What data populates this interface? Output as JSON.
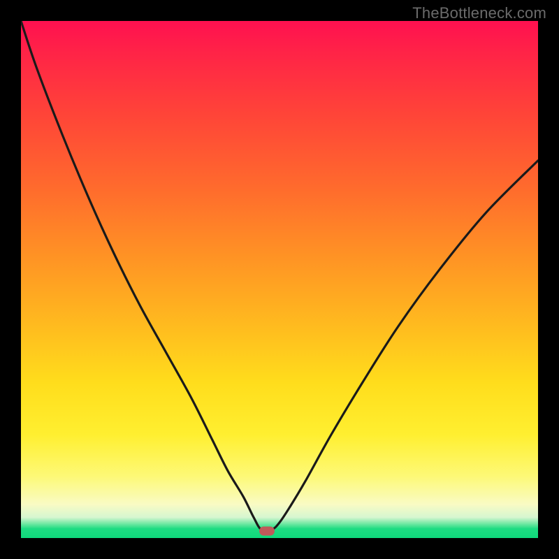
{
  "watermark": "TheBottleneck.com",
  "colors": {
    "page_bg": "#000000",
    "curve_stroke": "#1a1a1a",
    "marker_fill": "#c05a5a",
    "gradient_top": "#ff1050",
    "gradient_bottom": "#0fd87b"
  },
  "chart_data": {
    "type": "line",
    "title": "",
    "xlabel": "",
    "ylabel": "",
    "xlim": [
      0,
      100
    ],
    "ylim": [
      0,
      100
    ],
    "grid": false,
    "legend": false,
    "note": "Bottleneck-style V curve; x/y are screen-space percentages (top of plot = y 0, green band near y 100). Minimum sits on the green band around x≈47.",
    "series": [
      {
        "name": "bottleneck-curve",
        "x": [
          0,
          3,
          8,
          13,
          18,
          23,
          28,
          33,
          37,
          40,
          43,
          45,
          46.5,
          48.5,
          50,
          52,
          55,
          60,
          66,
          73,
          81,
          90,
          100
        ],
        "y": [
          0,
          9,
          22,
          34,
          45,
          55,
          64,
          73,
          81,
          87,
          92,
          96,
          98.4,
          98.4,
          97,
          94,
          89,
          80,
          70,
          59,
          48,
          37,
          27
        ]
      }
    ],
    "marker": {
      "x_percent": 47.5,
      "y_percent": 98.6
    }
  }
}
